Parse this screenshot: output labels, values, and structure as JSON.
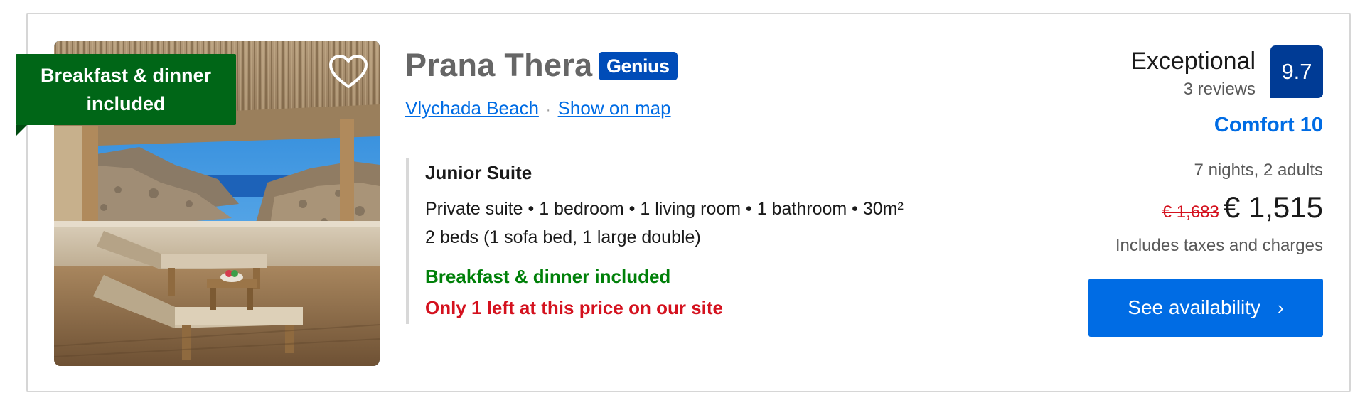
{
  "ribbon": {
    "label": "Breakfast & dinner included"
  },
  "hotel": {
    "name": "Prana Thera",
    "badge": "Genius",
    "area_link": "Vlychada Beach",
    "separator": "·",
    "map_link": "Show on map"
  },
  "room": {
    "title": "Junior Suite",
    "details": "Private suite • 1 bedroom • 1 living room • 1 bathroom • 30m²",
    "beds": "2 beds (1 sofa bed, 1 large double)",
    "meals": "Breakfast & dinner included",
    "scarcity": "Only 1 left at this price on our site"
  },
  "review": {
    "word": "Exceptional",
    "count": "3 reviews",
    "score": "9.7",
    "comfort": "Comfort 10"
  },
  "pricing": {
    "stay": "7 nights, 2 adults",
    "old_price": "€ 1,683",
    "new_price": "€ 1,515",
    "taxes": "Includes taxes and charges",
    "cta_label": "See availability",
    "cta_chevron": "›"
  },
  "colors": {
    "brand_blue": "#006ce4",
    "dark_blue": "#003b95",
    "genius_blue": "#004cb8",
    "green": "#008009",
    "ribbon_green": "#006617",
    "red": "#d4111e"
  },
  "icons": {
    "favorite": "heart-outline-icon",
    "cta": "chevron-right-icon"
  }
}
